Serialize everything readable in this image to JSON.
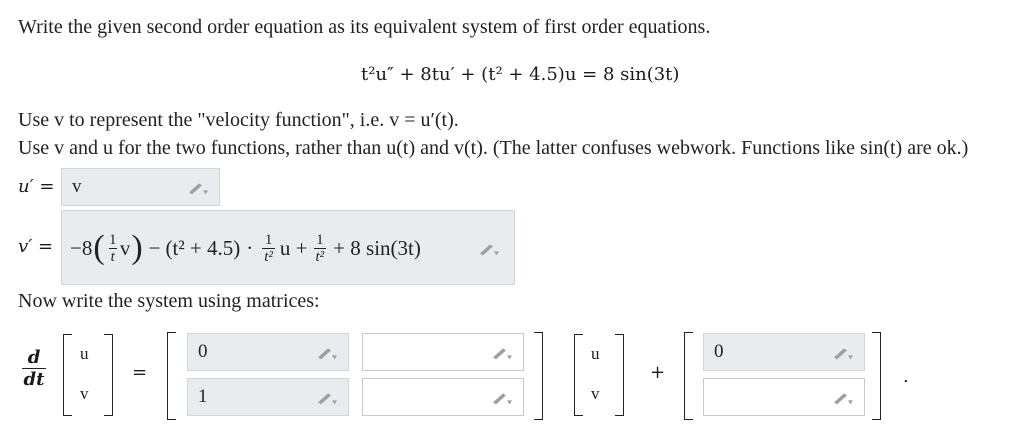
{
  "instruction": "Write the given second order equation as its equivalent system of first order equations.",
  "equation": "t²u″ + 8tu′ + (t² + 4.5)u = 8 sin(3t)",
  "note1": "Use v to represent the \"velocity function\", i.e. v = u′(t).",
  "note2": "Use v and u for the two functions, rather than u(t) and v(t). (The latter confuses webwork. Functions like sin(t) are ok.)",
  "u_prime": {
    "label": "u′ =",
    "answer": "v"
  },
  "v_prime": {
    "label": "v′ =",
    "answer_parts": {
      "neg8": "−8",
      "frac1_num": "1",
      "frac1_den": "t",
      "v": "v",
      "minus": "−",
      "t2_group": "(t² + 4.5)",
      "dot": "·",
      "frac2_num": "1",
      "frac2_den": "t²",
      "u_plus": "u +",
      "frac3_num": "1",
      "frac3_den": "t²",
      "tail": "+ 8 sin(3t)"
    }
  },
  "matrix_prompt": "Now write the system using matrices:",
  "matrix": {
    "d": "d",
    "dt": "dt",
    "vec_top": "u",
    "vec_bottom": "v",
    "equals": "=",
    "a11": "0",
    "a12": "",
    "a21": "1",
    "a22": "",
    "plus": "+",
    "f1": "0",
    "f2": "",
    "period": "."
  }
}
